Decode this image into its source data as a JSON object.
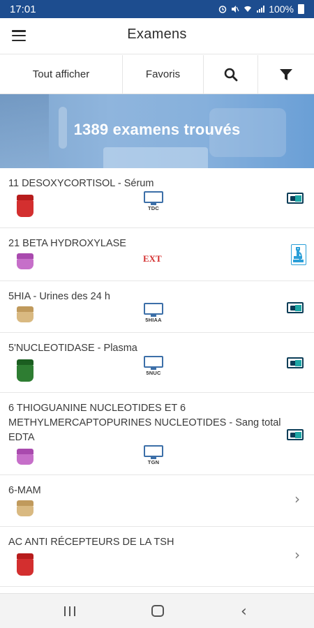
{
  "status_bar": {
    "time": "17:01",
    "battery": "100%"
  },
  "header": {
    "title": "Examens"
  },
  "toolbar": {
    "show_all": "Tout afficher",
    "favorites": "Favoris"
  },
  "banner": {
    "text": "1389 examens trouvés"
  },
  "exams": [
    {
      "name": "11 DESOXYCORTISOL - Sérum",
      "tube_color": "#d32f2f",
      "code": "TDC",
      "right_icon": "id-card-icon"
    },
    {
      "name": "21 BETA HYDROXYLASE",
      "tube_color": "#c66fc9",
      "code": "EXT",
      "right_icon": "microscope-icon"
    },
    {
      "name": "5HIA - Urines des 24 h",
      "tube_color": "#d9b981",
      "code": "5HIAA",
      "right_icon": "id-card-icon"
    },
    {
      "name": "5'NUCLEOTIDASE - Plasma",
      "tube_color": "#2e7d32",
      "code": "5NUC",
      "right_icon": "id-card-icon"
    },
    {
      "name": "6 THIOGUANINE NUCLEOTIDES ET 6 METHYLMERCAPTOPURINES NUCLEOTIDES - Sang total EDTA",
      "tube_color": "#c66fc9",
      "code": "TGN",
      "right_icon": "id-card-icon"
    },
    {
      "name": "6-MAM",
      "tube_color": "#d9b981",
      "code": "",
      "right_icon": "chevron-right-icon"
    },
    {
      "name": "AC ANTI RÉCEPTEURS DE LA TSH",
      "tube_color": "#d32f2f",
      "code": "",
      "right_icon": "chevron-right-icon"
    }
  ],
  "colors": {
    "status_bar": "#1d4d8f",
    "banner": "#86b0dc",
    "ext_red": "#d32f2f",
    "card_teal": "#1ea7a6"
  }
}
